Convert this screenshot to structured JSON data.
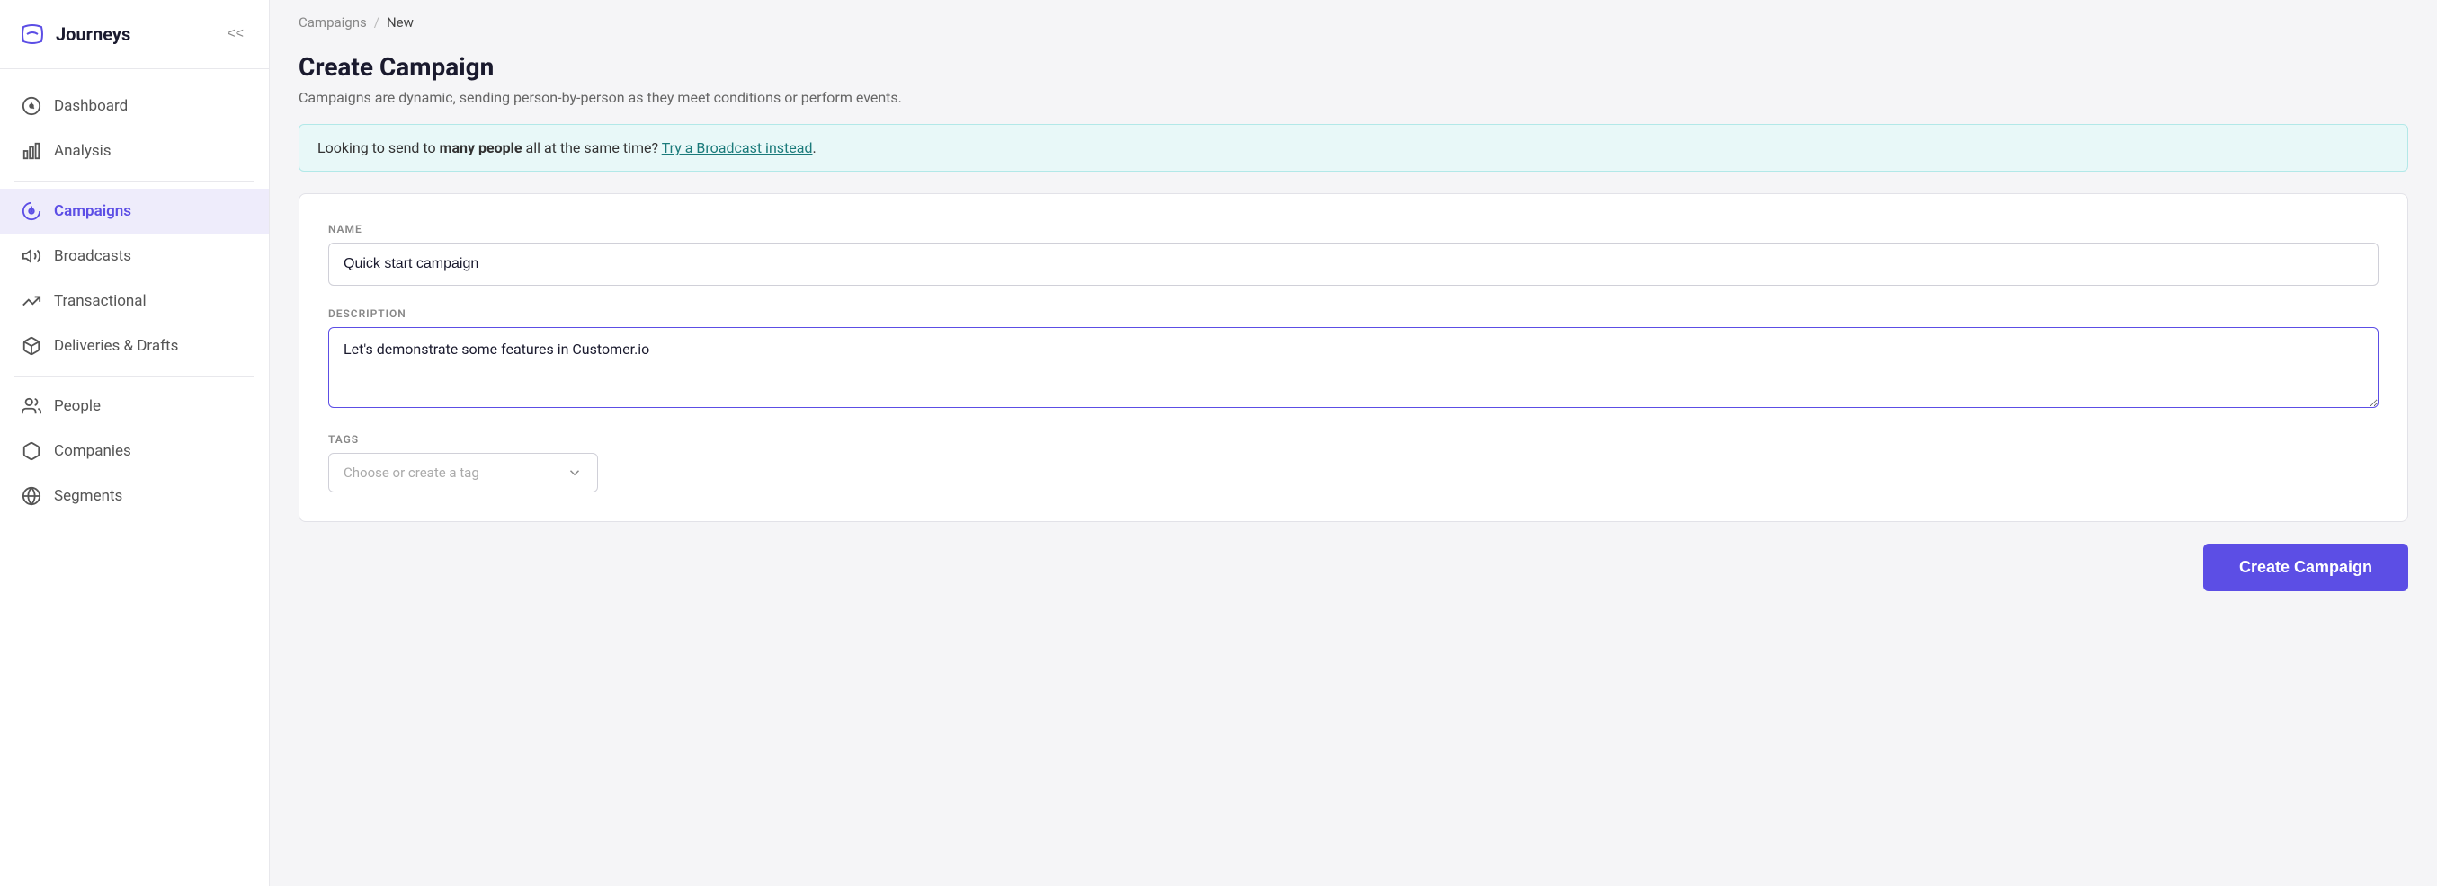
{
  "sidebar": {
    "title": "Journeys",
    "collapse_label": "<<",
    "nav_items": [
      {
        "id": "dashboard",
        "label": "Dashboard",
        "icon": "dashboard-icon",
        "active": false
      },
      {
        "id": "analysis",
        "label": "Analysis",
        "icon": "analysis-icon",
        "active": false
      },
      {
        "id": "campaigns",
        "label": "Campaigns",
        "icon": "campaigns-icon",
        "active": true
      },
      {
        "id": "broadcasts",
        "label": "Broadcasts",
        "icon": "broadcasts-icon",
        "active": false
      },
      {
        "id": "transactional",
        "label": "Transactional",
        "icon": "transactional-icon",
        "active": false
      },
      {
        "id": "deliveries-drafts",
        "label": "Deliveries & Drafts",
        "icon": "deliveries-icon",
        "active": false
      },
      {
        "id": "people",
        "label": "People",
        "icon": "people-icon",
        "active": false
      },
      {
        "id": "companies",
        "label": "Companies",
        "icon": "companies-icon",
        "active": false
      },
      {
        "id": "segments",
        "label": "Segments",
        "icon": "segments-icon",
        "active": false
      }
    ]
  },
  "breadcrumb": {
    "items": [
      {
        "label": "Campaigns",
        "href": "#"
      },
      {
        "label": "New",
        "href": null
      }
    ]
  },
  "page": {
    "title": "Create Campaign",
    "subtitle": "Campaigns are dynamic, sending person-by-person as they meet conditions or perform events."
  },
  "info_banner": {
    "text_before": "Looking to send to ",
    "text_bold": "many people",
    "text_after": " all at the same time?",
    "link_text": "Try a Broadcast instead",
    "link_suffix": "."
  },
  "form": {
    "name_label": "NAME",
    "name_value": "Quick start campaign",
    "name_placeholder": "",
    "description_label": "DESCRIPTION",
    "description_value": "Let's demonstrate some features in Customer.io",
    "description_placeholder": "",
    "tags_label": "TAGS",
    "tags_placeholder": "Choose or create a tag"
  },
  "footer": {
    "create_button_label": "Create Campaign"
  },
  "colors": {
    "accent": "#5c4ee5"
  }
}
